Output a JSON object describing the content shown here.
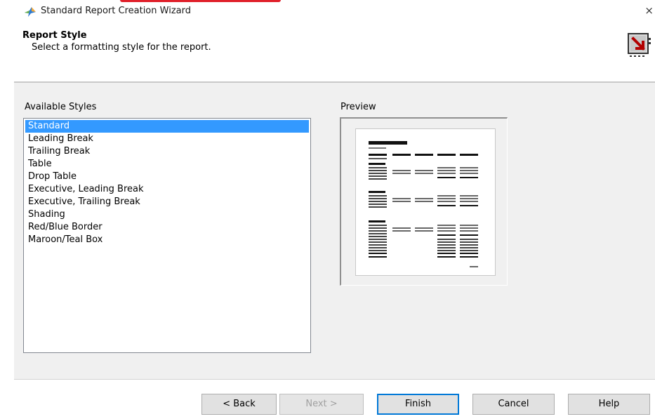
{
  "window": {
    "title": "Standard Report Creation Wizard",
    "close_glyph": "×"
  },
  "header": {
    "title": "Report Style",
    "subtitle": "Select a formatting style for the report.",
    "icon": "report-wizard-icon"
  },
  "styles": {
    "label": "Available Styles",
    "selected_index": 0,
    "items": [
      "Standard",
      "Leading Break",
      "Trailing Break",
      "Table",
      "Drop Table",
      "Executive, Leading Break",
      "Executive, Trailing Break",
      "Shading",
      "Red/Blue Border",
      "Maroon/Teal Box"
    ]
  },
  "preview": {
    "label": "Preview"
  },
  "buttons": {
    "back": "< Back",
    "next": "Next >",
    "finish": "Finish",
    "cancel": "Cancel",
    "help": "Help"
  },
  "colors": {
    "selection": "#3399ff",
    "accent_red": "#e0202a",
    "focus_border": "#0078d7"
  }
}
